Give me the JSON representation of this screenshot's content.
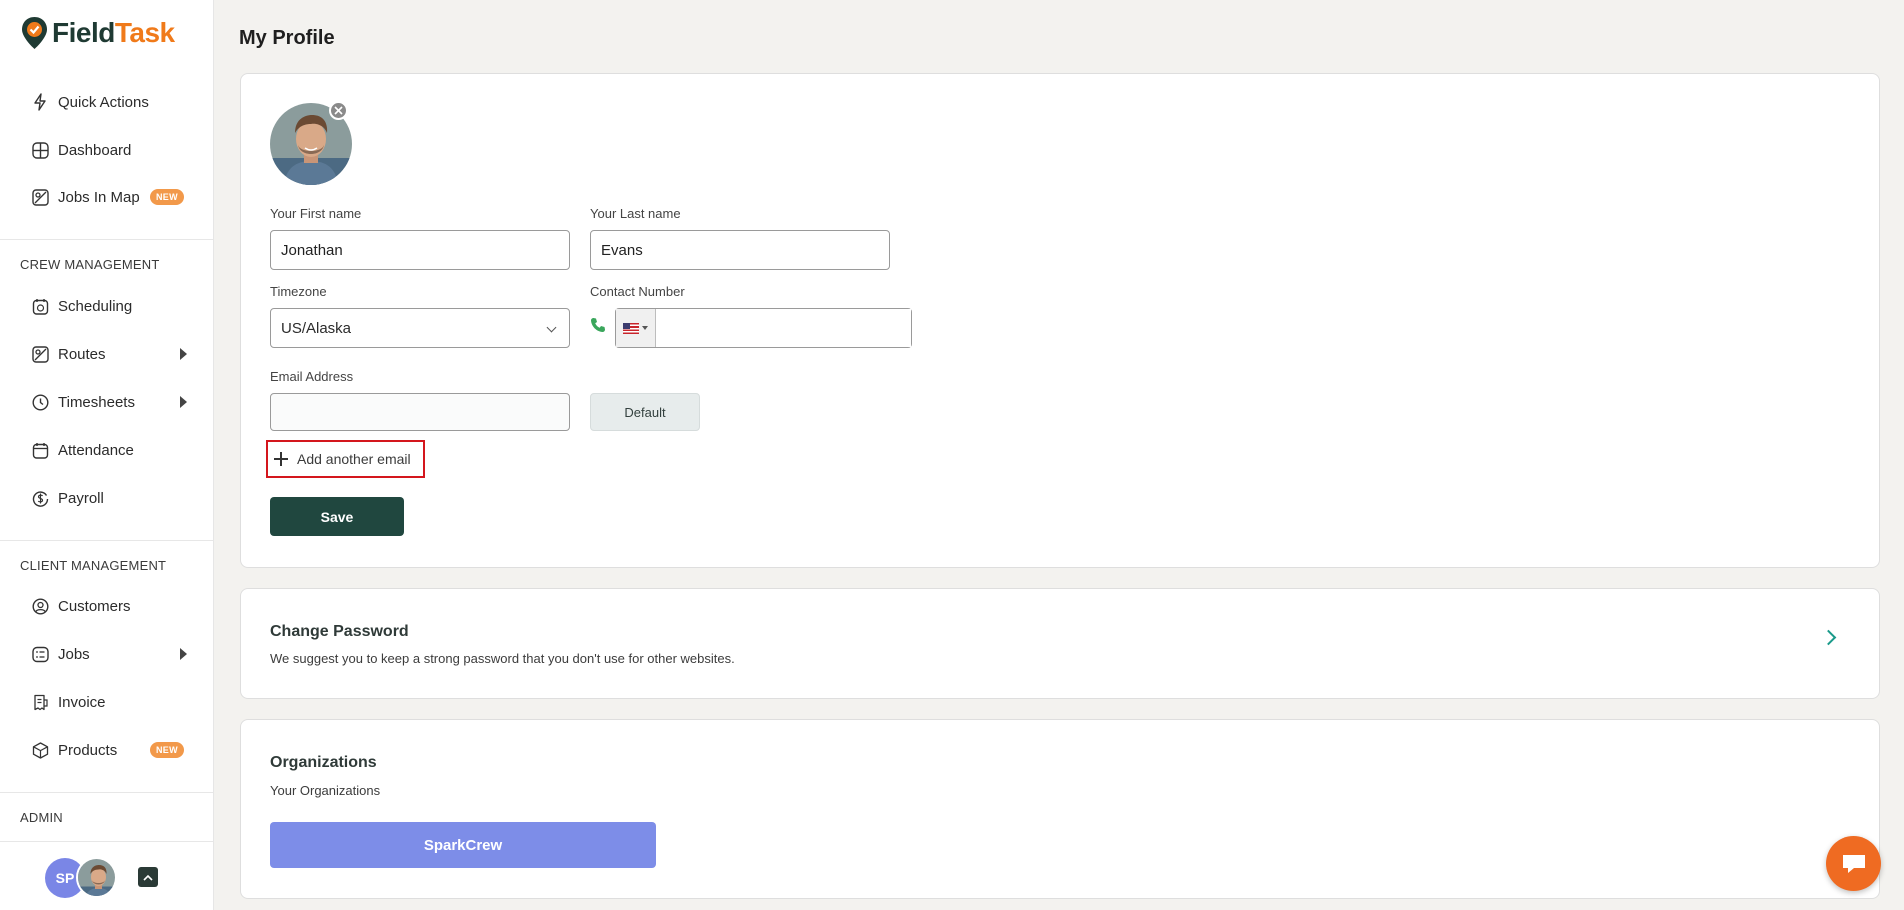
{
  "brand": {
    "name_part1": "Field",
    "name_part2": "Task",
    "accent": "#f07a1a",
    "dark": "#1f3a33"
  },
  "sidebar": {
    "top_items": [
      {
        "label": "Quick Actions",
        "icon": "lightning-icon"
      },
      {
        "label": "Dashboard",
        "icon": "dashboard-grid-icon"
      },
      {
        "label": "Jobs In Map",
        "icon": "map-icon",
        "badge": "NEW"
      }
    ],
    "crew_section": "CREW MANAGEMENT",
    "crew_items": [
      {
        "label": "Scheduling",
        "icon": "calendar-clock-icon"
      },
      {
        "label": "Routes",
        "icon": "route-map-icon",
        "expandable": true
      },
      {
        "label": "Timesheets",
        "icon": "clock-icon",
        "expandable": true
      },
      {
        "label": "Attendance",
        "icon": "attendance-calendar-icon"
      },
      {
        "label": "Payroll",
        "icon": "dollar-cycle-icon"
      }
    ],
    "client_section": "CLIENT MANAGEMENT",
    "client_items": [
      {
        "label": "Customers",
        "icon": "user-circle-icon"
      },
      {
        "label": "Jobs",
        "icon": "jobs-list-icon",
        "expandable": true
      },
      {
        "label": "Invoice",
        "icon": "invoice-icon"
      },
      {
        "label": "Products",
        "icon": "box-icon",
        "badge": "NEW"
      }
    ],
    "admin_section": "ADMIN",
    "user_initials": "SP"
  },
  "page": {
    "title": "My Profile"
  },
  "profile": {
    "first_name_label": "Your First name",
    "first_name": "Jonathan",
    "last_name_label": "Your Last name",
    "last_name": "Evans",
    "timezone_label": "Timezone",
    "timezone": "US/Alaska",
    "contact_label": "Contact Number",
    "contact_value": "",
    "email_label": "Email Address",
    "email_value": "",
    "default_button": "Default",
    "add_email": "Add another email",
    "save": "Save"
  },
  "password": {
    "title": "Change Password",
    "description": "We suggest you to keep a strong password that you don't use for other websites."
  },
  "organizations": {
    "title": "Organizations",
    "subtitle": "Your Organizations",
    "items": [
      "SparkCrew"
    ]
  },
  "colors": {
    "save": "#20473f",
    "org_button": "#7d8de8",
    "chat": "#ef6b22",
    "highlight": "#d4161d"
  }
}
